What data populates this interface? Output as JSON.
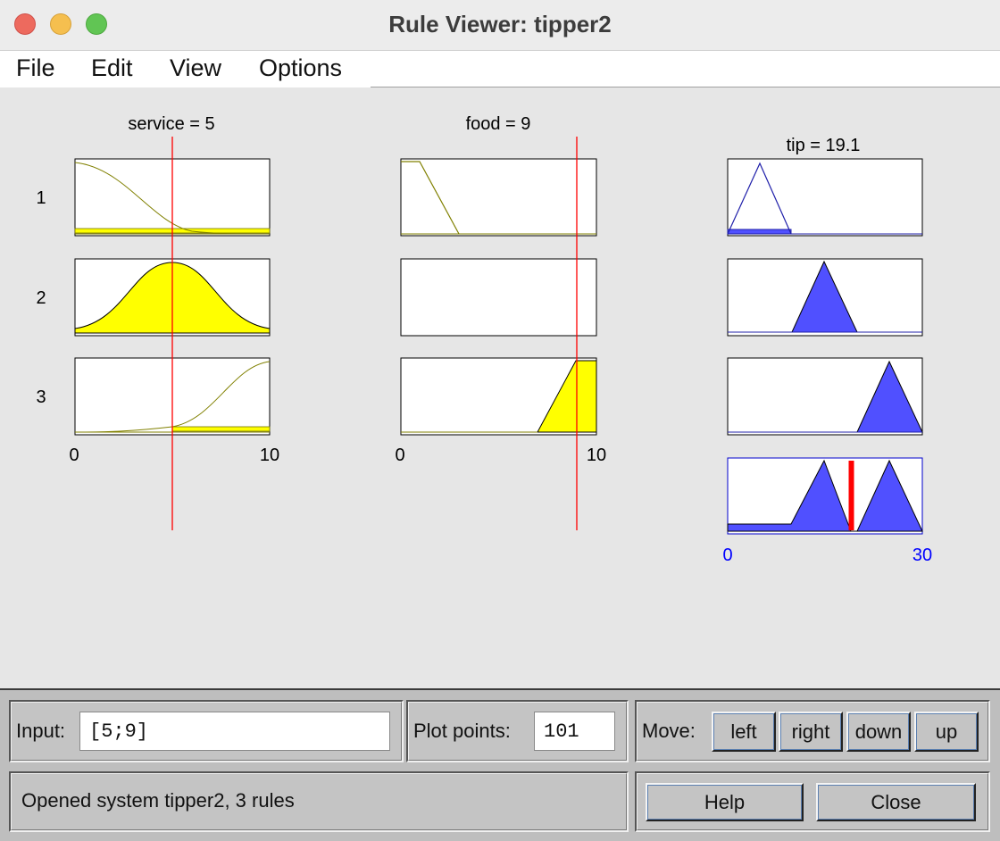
{
  "window": {
    "title": "Rule Viewer: tipper2"
  },
  "menu": [
    "File",
    "Edit",
    "View",
    "Options"
  ],
  "plot": {
    "inputs": [
      {
        "label": "service = 5",
        "axis_min": "0",
        "axis_max": "10"
      },
      {
        "label": "food = 9",
        "axis_min": "0",
        "axis_max": "10"
      }
    ],
    "output": {
      "label": "tip = 19.1",
      "axis_min": "0",
      "axis_max": "30"
    },
    "rules": [
      "1",
      "2",
      "3"
    ],
    "colors": {
      "input_fill": "#ffff00",
      "output_fill": "#5050ff",
      "cursor": "#ff0000",
      "axis_blue": "#0000ff"
    }
  },
  "controls": {
    "input_label": "Input:",
    "input_value": "[5;9]",
    "plot_points_label": "Plot points:",
    "plot_points_value": "101",
    "move_label": "Move:",
    "move_buttons": [
      "left",
      "right",
      "down",
      "up"
    ],
    "status": "Opened system tipper2, 3 rules",
    "help_label": "Help",
    "close_label": "Close"
  }
}
